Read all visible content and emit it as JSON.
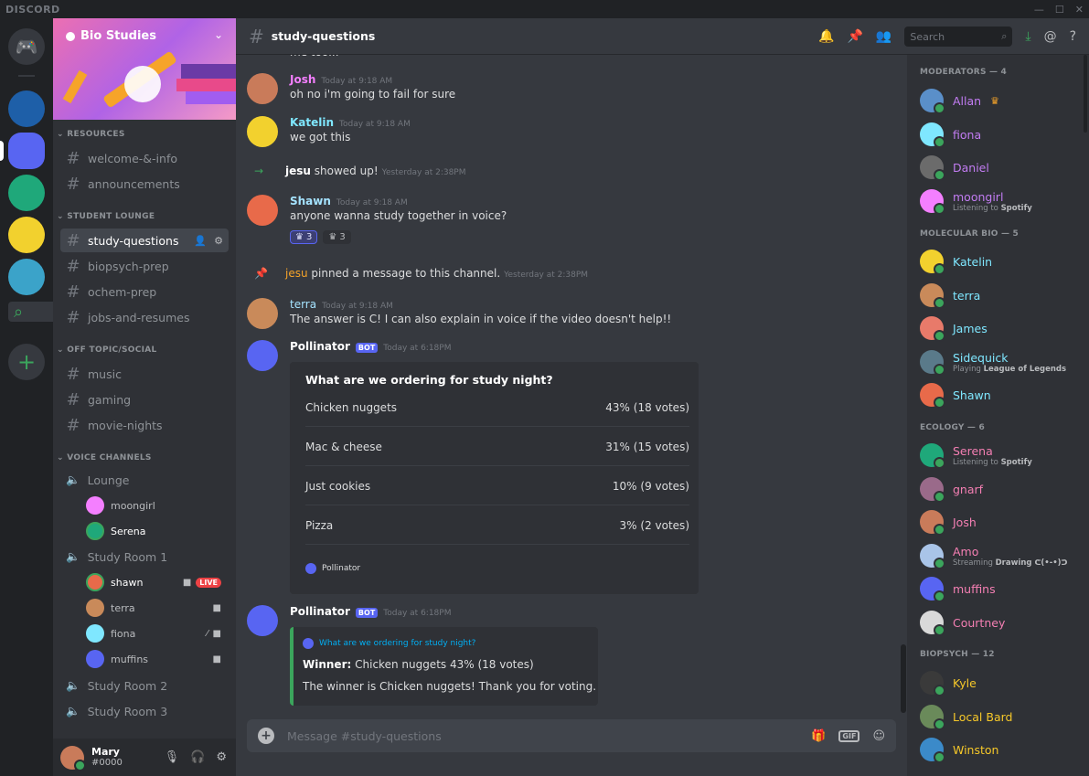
{
  "window": {
    "brand": "DISCORD"
  },
  "server": {
    "name": "Bio Studies"
  },
  "sidebar": {
    "categories": [
      "RESOURCES",
      "STUDENT LOUNGE",
      "OFF TOPIC/SOCIAL",
      "VOICE CHANNELS"
    ],
    "resources": [
      "welcome-&-info",
      "announcements"
    ],
    "lounge": [
      "study-questions",
      "biopsych-prep",
      "ochem-prep",
      "jobs-and-resumes"
    ],
    "offtopic": [
      "music",
      "gaming",
      "movie-nights"
    ],
    "voice": {
      "lounge": {
        "name": "Lounge",
        "users": [
          "moongirl",
          "Serena"
        ]
      },
      "room1": {
        "name": "Study Room 1",
        "users": [
          "shawn",
          "terra",
          "fiona",
          "muffins"
        ]
      },
      "room2": "Study Room 2",
      "room3": "Study Room 3"
    },
    "live_label": "LIVE"
  },
  "user": {
    "name": "Mary",
    "tag": "#0000"
  },
  "header": {
    "channel": "study-questions",
    "search_placeholder": "Search"
  },
  "messages": {
    "partial": "me too...",
    "m1": {
      "author": "Josh",
      "color": "#f47fff",
      "time": "Today at 9:18 AM",
      "text": "oh no i'm going to fail for sure"
    },
    "m2": {
      "author": "Katelin",
      "color": "#7fe7ff",
      "time": "Today at 9:18 AM",
      "text": "we got this"
    },
    "sys1": {
      "author": "jesu",
      "text": "showed up!",
      "time": "Yesterday at 2:38PM"
    },
    "m3": {
      "author": "Shawn",
      "color": "#a5e3ff",
      "time": "Today at 9:18 AM",
      "text": "anyone wanna study together in voice?",
      "reactions": [
        "3",
        "3"
      ]
    },
    "sys2": {
      "author": "jesu",
      "text": "pinned a message to this channel.",
      "time": "Yesterday at 2:38PM"
    },
    "m4": {
      "author": "terra",
      "color": "#a5e3ff",
      "time": "Today at 9:18 AM",
      "text": "The answer is C! I can also explain in voice if the video doesn't help!!"
    },
    "poll": {
      "author": "Pollinator",
      "badge": "BOT",
      "time": "Today at 6:18PM",
      "question": "What are we ordering for study night?",
      "options": [
        {
          "label": "Chicken nuggets",
          "result": "43% (18 votes)"
        },
        {
          "label": "Mac & cheese",
          "result": "31% (15 votes)"
        },
        {
          "label": "Just cookies",
          "result": "10% (9 votes)"
        },
        {
          "label": "Pizza",
          "result": "3% (2 votes)"
        }
      ],
      "footer": "Pollinator"
    },
    "result": {
      "author": "Pollinator",
      "badge": "BOT",
      "time": "Today at 6:18PM",
      "link": "What are we ordering for study night?",
      "winner_label": "Winner:",
      "winner_text": "Chicken nuggets 43% (18 votes)",
      "thanks": "The winner is Chicken nuggets! Thank you for voting."
    }
  },
  "composer": {
    "placeholder": "Message #study-questions",
    "gif": "GIF"
  },
  "members": {
    "moderators": {
      "title": "MODERATORS — 4",
      "list": [
        "Allan",
        "fiona",
        "Daniel",
        "moongirl"
      ],
      "moongirl_sub": "Listening to",
      "moongirl_sub_b": "Spotify"
    },
    "molecular": {
      "title": "MOLECULAR BIO — 5",
      "list": [
        "Katelin",
        "terra",
        "James",
        "Sidequick",
        "Shawn"
      ],
      "sidequick_sub": "Playing",
      "sidequick_sub_b": "League of Legends"
    },
    "ecology": {
      "title": "ECOLOGY — 6",
      "list": [
        "Serena",
        "gnarf",
        "Josh",
        "Amo",
        "muffins",
        "Courtney"
      ],
      "serena_sub": "Listening to",
      "serena_sub_b": "Spotify",
      "amo_sub": "Streaming",
      "amo_sub_b": "Drawing ᕦ(•-•)ᕤ"
    },
    "biopsych": {
      "title": "BIOPSYCH — 12",
      "list": [
        "Kyle",
        "Local Bard",
        "Winston"
      ]
    }
  }
}
